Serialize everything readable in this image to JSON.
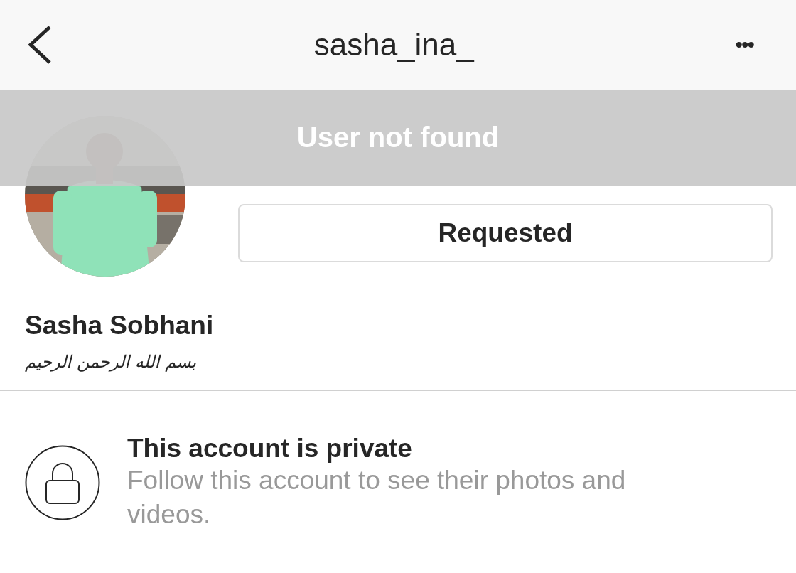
{
  "header": {
    "title": "sasha_ina_",
    "more": "•••"
  },
  "toast": {
    "message": "User not found"
  },
  "profile": {
    "button": "Requested",
    "name": "Sasha Sobhani",
    "bio": "بسم الله الرحمن الرحيم"
  },
  "private_notice": {
    "title": "This account is private",
    "message": "Follow this account to see their photos and videos."
  }
}
